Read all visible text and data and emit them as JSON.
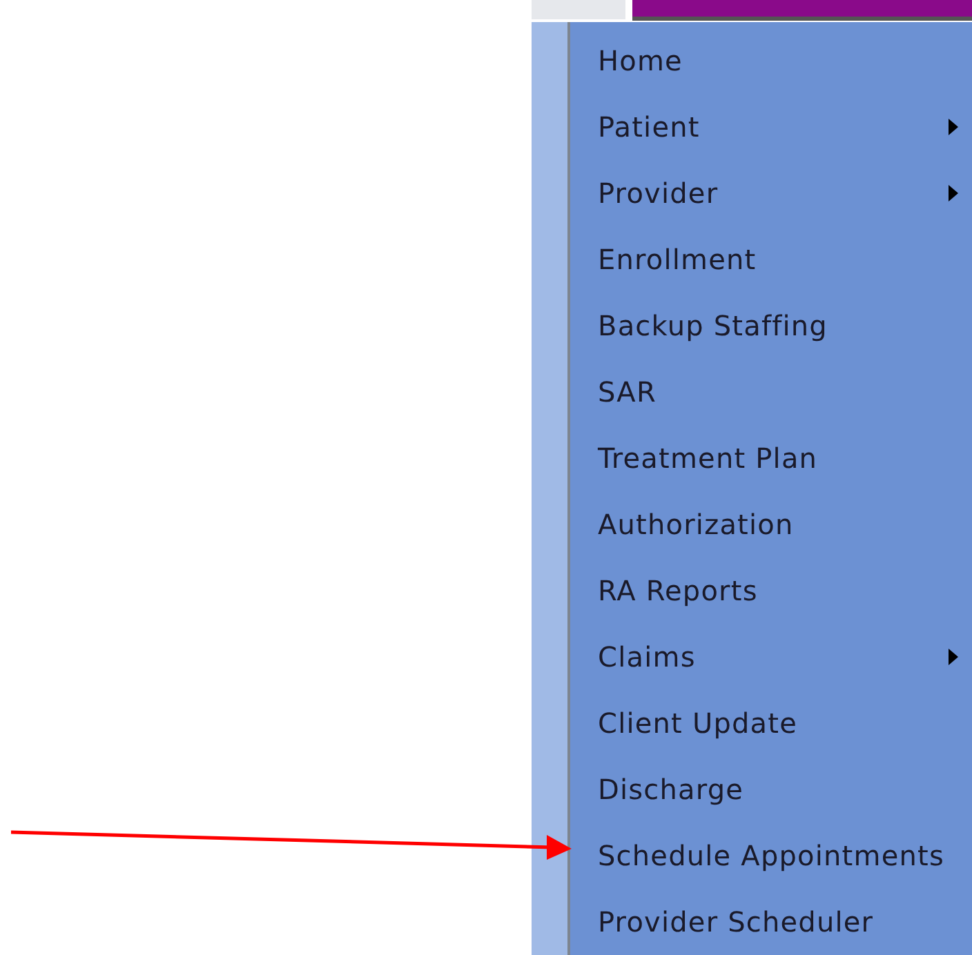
{
  "menu": {
    "items": [
      {
        "label": "Home",
        "submenu": false
      },
      {
        "label": "Patient",
        "submenu": true
      },
      {
        "label": "Provider",
        "submenu": true
      },
      {
        "label": "Enrollment",
        "submenu": false
      },
      {
        "label": "Backup Staffing",
        "submenu": false
      },
      {
        "label": "SAR",
        "submenu": false
      },
      {
        "label": "Treatment Plan",
        "submenu": false
      },
      {
        "label": "Authorization",
        "submenu": false
      },
      {
        "label": "RA Reports",
        "submenu": false
      },
      {
        "label": "Claims",
        "submenu": true
      },
      {
        "label": "Client Update",
        "submenu": false
      },
      {
        "label": "Discharge",
        "submenu": false
      },
      {
        "label": "Schedule Appointments",
        "submenu": false
      },
      {
        "label": "Provider Scheduler",
        "submenu": false
      }
    ]
  }
}
